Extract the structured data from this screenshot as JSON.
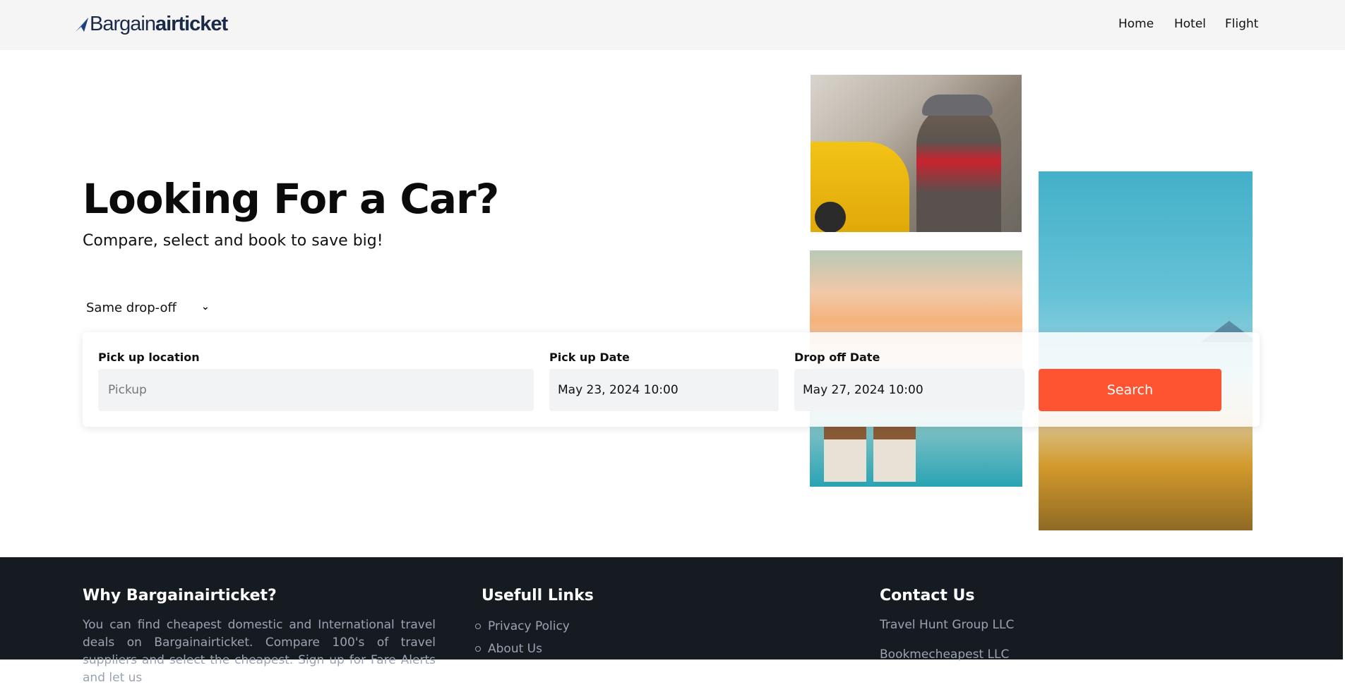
{
  "nav": {
    "logo_light": "Bargain",
    "logo_bold": "airticket",
    "links": [
      "Home",
      "Hotel",
      "Flight"
    ]
  },
  "hero": {
    "title": "Looking For a Car?",
    "subtitle": "Compare, select and book to save big!",
    "dropoff_option": "Same drop-off"
  },
  "search": {
    "pickup_label": "Pick up location",
    "pickup_placeholder": "Pickup",
    "pickup_date_label": "Pick up Date",
    "pickup_date_value": "May 23, 2024 10:00",
    "dropoff_date_label": "Drop off Date",
    "dropoff_date_value": "May 27, 2024 10:00",
    "button_label": "Search"
  },
  "colors": {
    "accent": "#fe5431",
    "footer_bg": "#161b22",
    "nav_bg": "#f5f5f5"
  },
  "footer": {
    "why_title": "Why Bargainairticket?",
    "why_text": "You can find cheapest domestic and International travel deals on Bargainairticket. Compare 100's of travel suppliers and select the cheapest. Sign up for Fare Alerts and let us",
    "links_title": "Usefull Links",
    "links": [
      "Privacy Policy",
      "About Us"
    ],
    "contact_title": "Contact Us",
    "contacts": [
      "Travel Hunt Group LLC",
      "Bookmecheapest LLC"
    ]
  }
}
